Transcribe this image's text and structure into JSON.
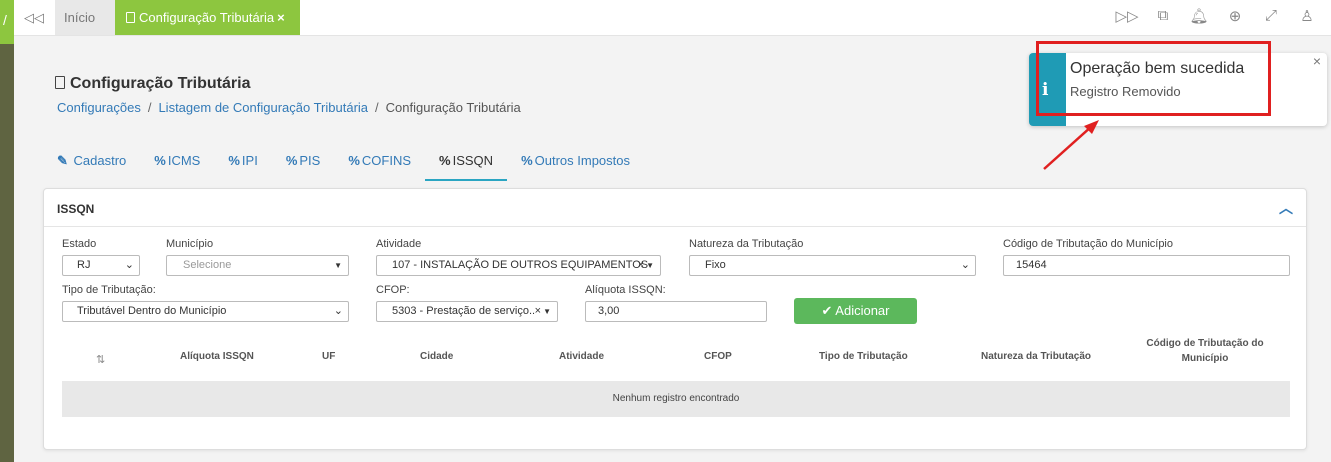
{
  "topbar": {
    "tab_home": "Início",
    "tab_active": "Configuração Tributária",
    "tab_close": "×"
  },
  "header": {
    "title": "Configuração Tributária",
    "breadcrumb": [
      "Configurações",
      "Listagem de Configuração Tributária",
      "Configuração Tributária"
    ],
    "separator": "/"
  },
  "tabs": [
    {
      "label": "Cadastro",
      "icon": "edit-icon",
      "glyph": "✎"
    },
    {
      "label": "ICMS",
      "icon": "percent-icon",
      "glyph": "%"
    },
    {
      "label": "IPI",
      "icon": "percent-icon",
      "glyph": "%"
    },
    {
      "label": "PIS",
      "icon": "percent-icon",
      "glyph": "%"
    },
    {
      "label": "COFINS",
      "icon": "percent-icon",
      "glyph": "%"
    },
    {
      "label": "ISSQN",
      "icon": "percent-icon",
      "glyph": "%",
      "active": true
    },
    {
      "label": "Outros Impostos",
      "icon": "percent-icon",
      "glyph": "%"
    }
  ],
  "panel": {
    "title": "ISSQN",
    "form": {
      "estado": {
        "label": "Estado",
        "value": "RJ"
      },
      "municipio": {
        "label": "Município",
        "placeholder": "Selecione"
      },
      "atividade": {
        "label": "Atividade",
        "value": "107 - INSTALAÇÃO DE OUTROS EQUIPAMENTOS"
      },
      "natureza": {
        "label": "Natureza da Tributação",
        "value": "Fixo"
      },
      "codigo": {
        "label": "Código de Tributação do Município",
        "value": "15464"
      },
      "tipo": {
        "label": "Tipo de Tributação:",
        "value": "Tributável Dentro do Município"
      },
      "cfop": {
        "label": "CFOP:",
        "value": "5303 - Prestação de serviço..."
      },
      "aliquota": {
        "label": "Alíquota ISSQN:",
        "value": "3,00"
      }
    },
    "add_button": "Adicionar",
    "table": {
      "sort_icon": "⇅",
      "columns": [
        "Alíquota ISSQN",
        "UF",
        "Cidade",
        "Atividade",
        "CFOP",
        "Tipo de Tributação",
        "Natureza da Tributação",
        "Código de Tributação do Município"
      ],
      "empty_text": "Nenhum registro encontrado"
    }
  },
  "toast": {
    "icon": "i",
    "title": "Operação bem sucedida",
    "message": "Registro Removido",
    "close": "×"
  },
  "colors": {
    "brand_green": "#8dc63f",
    "link_blue": "#337ab7",
    "toast_info": "#1f9bb5",
    "add_button": "#5cb85c",
    "annotation_red": "#e02020"
  }
}
